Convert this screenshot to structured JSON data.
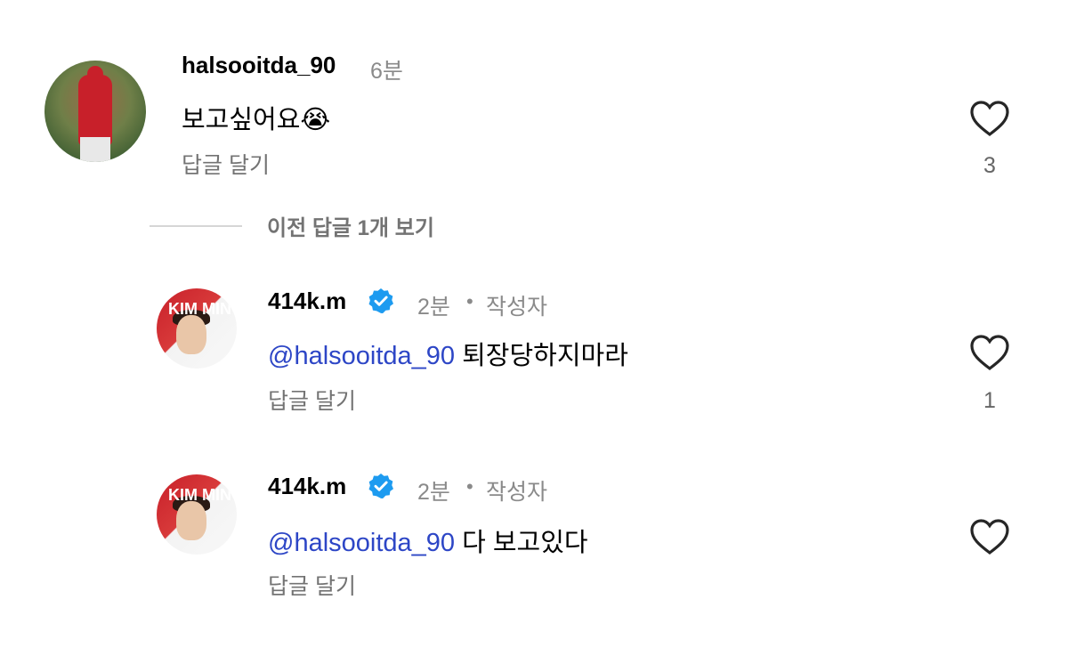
{
  "main_comment": {
    "username": "halsooitda_90",
    "time": "6분",
    "text": "보고싶어요",
    "emoji": "😭",
    "reply_label": "답글 달기",
    "likes": "3",
    "heart_icon": "heart-icon"
  },
  "view_previous": "이전 답글 1개 보기",
  "replies": [
    {
      "username": "414k.m",
      "time": "2분",
      "separator": "•",
      "author_label": "작성자",
      "mention": "@halsooitda_90",
      "text": "퇴장당하지마라",
      "reply_label": "답글 달기",
      "likes": "1",
      "avatar_text": "KIM MIN",
      "verified_color": "#1d9bf0"
    },
    {
      "username": "414k.m",
      "time": "2분",
      "separator": "•",
      "author_label": "작성자",
      "mention": "@halsooitda_90",
      "text": "다 보고있다",
      "reply_label": "답글 달기",
      "likes": "",
      "avatar_text": "KIM MIN",
      "verified_color": "#1d9bf0"
    }
  ]
}
